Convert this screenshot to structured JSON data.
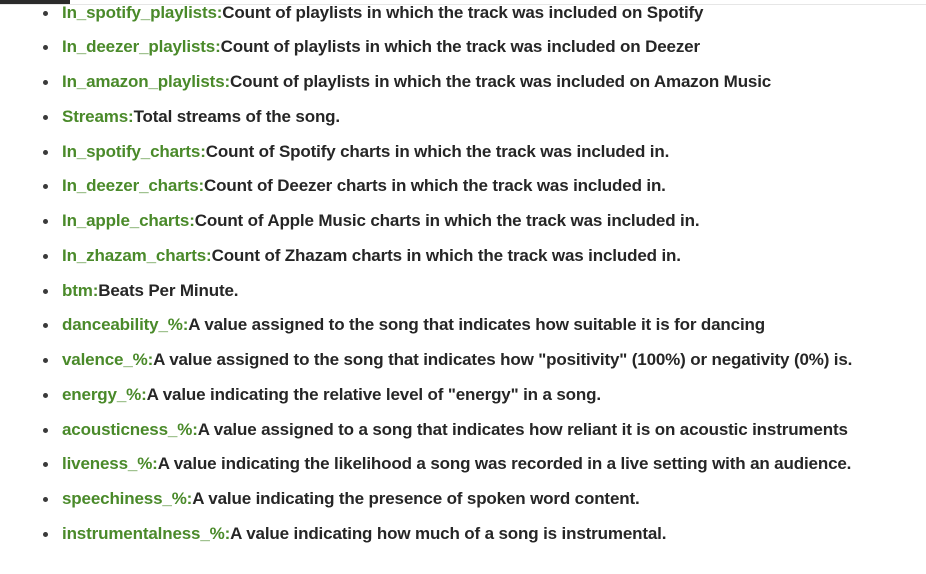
{
  "accent_color": "#4a8a2a",
  "items": [
    {
      "term": "In_spotify_playlists:",
      "desc": "Count of playlists in which the track was included on Spotify"
    },
    {
      "term": "In_deezer_playlists:",
      "desc": "Count of playlists in which the track was included on Deezer"
    },
    {
      "term": "In_amazon_playlists:",
      "desc": "Count of playlists in which the track was included on Amazon Music"
    },
    {
      "term": "Streams:",
      "desc": "Total streams of the song."
    },
    {
      "term": "In_spotify_charts:",
      "desc": "Count of Spotify charts in which the track was included in."
    },
    {
      "term": "In_deezer_charts:",
      "desc": "Count of Deezer charts in which the track was included in."
    },
    {
      "term": "In_apple_charts:",
      "desc": "Count of Apple Music charts in which the track was included in."
    },
    {
      "term": "In_zhazam_charts:",
      "desc": "Count of Zhazam charts in which the track was included in."
    },
    {
      "term": "btm:",
      "desc": "Beats Per Minute."
    },
    {
      "term": "danceability_%:",
      "desc": "A value assigned to the song that indicates how suitable it is for dancing"
    },
    {
      "term": "valence_%:",
      "desc": "A value assigned to the song that indicates how \"positivity\" (100%) or negativity (0%) is."
    },
    {
      "term": "energy_%:",
      "desc": "A value indicating the relative level of \"energy\" in a song."
    },
    {
      "term": "acousticness_%:",
      "desc": "A value assigned to a song that indicates how reliant it is on acoustic instruments"
    },
    {
      "term": "liveness_%:",
      "desc": "A value indicating the likelihood a song was recorded in a live setting with an audience."
    },
    {
      "term": "speechiness_%:",
      "desc": "A value indicating the presence of spoken word content."
    },
    {
      "term": "instrumentalness_%:",
      "desc": "A value indicating how much of a song is instrumental."
    }
  ]
}
